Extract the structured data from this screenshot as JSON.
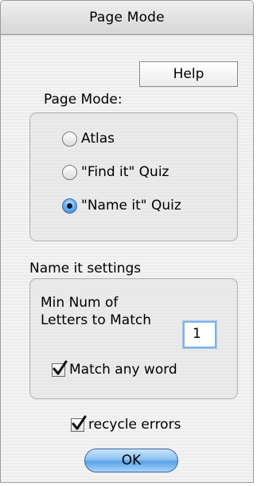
{
  "window": {
    "title": "Page Mode"
  },
  "help_button": {
    "label": "Help"
  },
  "page_mode": {
    "label": "Page Mode:",
    "options": [
      {
        "label": "Atlas",
        "selected": false
      },
      {
        "label": "\"Find it\" Quiz",
        "selected": false
      },
      {
        "label": "\"Name it\" Quiz",
        "selected": true
      }
    ]
  },
  "name_it_settings": {
    "label": "Name it settings",
    "min_letters_label_line1": "Min Num of",
    "min_letters_label_line2": "Letters to Match",
    "min_letters_value": "1",
    "match_any_word": {
      "label": "Match any word",
      "checked": true
    }
  },
  "recycle_errors": {
    "label": "recycle errors",
    "checked": true
  },
  "ok_button": {
    "label": "OK"
  },
  "colors": {
    "accent": "#5aa2e6",
    "focus_ring": "#7fb0e6"
  }
}
